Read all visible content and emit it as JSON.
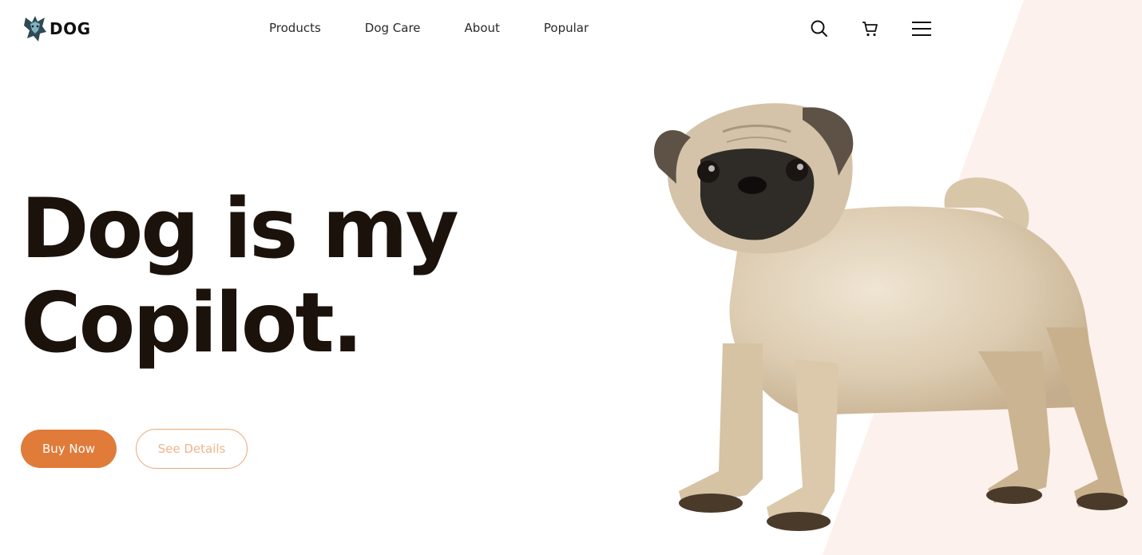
{
  "brand": {
    "name": "DOG",
    "logo_icon": "wolf-head-icon"
  },
  "nav": {
    "items": [
      {
        "label": "Products"
      },
      {
        "label": "Dog Care"
      },
      {
        "label": "About"
      },
      {
        "label": "Popular"
      }
    ],
    "icons": [
      "search-icon",
      "cart-icon",
      "hamburger-menu-icon"
    ]
  },
  "hero": {
    "title_line1": "Dog is my",
    "title_line2": "Copilot.",
    "primary_button": "Buy Now",
    "secondary_button": "See Details",
    "image": "pug-puppy"
  },
  "colors": {
    "accent": "#e07b3a",
    "title": "#1b120b",
    "background_shape": "#fcf1ec"
  }
}
